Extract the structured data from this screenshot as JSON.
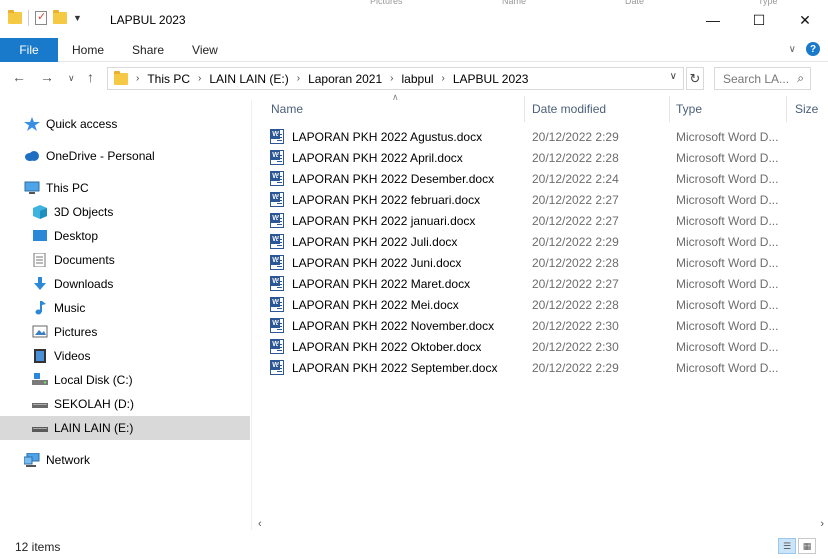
{
  "window": {
    "title": "LAPBUL 2023",
    "background_bleed": [
      "Pictures",
      "Name",
      "Date",
      "Type"
    ]
  },
  "ribbon": {
    "file_tab": "File",
    "tabs": [
      "Home",
      "Share",
      "View"
    ]
  },
  "address": {
    "breadcrumbs": [
      "This PC",
      "LAIN LAIN (E:)",
      "Laporan 2021",
      "labpul",
      "LAPBUL 2023"
    ],
    "search_placeholder": "Search LA..."
  },
  "nav_pane": {
    "items": [
      {
        "label": "Quick access",
        "icon": "star-icon"
      },
      {
        "label": "OneDrive - Personal",
        "icon": "cloud-icon"
      },
      {
        "label": "This PC",
        "icon": "computer-icon"
      },
      {
        "label": "3D Objects",
        "icon": "cube-icon"
      },
      {
        "label": "Desktop",
        "icon": "desktop-icon"
      },
      {
        "label": "Documents",
        "icon": "documents-icon"
      },
      {
        "label": "Downloads",
        "icon": "download-icon"
      },
      {
        "label": "Music",
        "icon": "music-icon"
      },
      {
        "label": "Pictures",
        "icon": "pictures-icon"
      },
      {
        "label": "Videos",
        "icon": "videos-icon"
      },
      {
        "label": "Local Disk (C:)",
        "icon": "drive-icon"
      },
      {
        "label": "SEKOLAH (D:)",
        "icon": "drive-icon"
      },
      {
        "label": "LAIN LAIN (E:)",
        "icon": "drive-icon",
        "selected": true
      },
      {
        "label": "Network",
        "icon": "network-icon"
      }
    ]
  },
  "file_list": {
    "columns": [
      "Name",
      "Date modified",
      "Type",
      "Size"
    ],
    "files": [
      {
        "name": "LAPORAN PKH 2022 Agustus.docx",
        "date": "20/12/2022 2:29",
        "type": "Microsoft Word D..."
      },
      {
        "name": "LAPORAN PKH 2022 April.docx",
        "date": "20/12/2022 2:28",
        "type": "Microsoft Word D..."
      },
      {
        "name": "LAPORAN PKH 2022 Desember.docx",
        "date": "20/12/2022 2:24",
        "type": "Microsoft Word D..."
      },
      {
        "name": "LAPORAN PKH 2022 februari.docx",
        "date": "20/12/2022 2:27",
        "type": "Microsoft Word D..."
      },
      {
        "name": "LAPORAN PKH 2022 januari.docx",
        "date": "20/12/2022 2:27",
        "type": "Microsoft Word D..."
      },
      {
        "name": "LAPORAN PKH 2022 Juli.docx",
        "date": "20/12/2022 2:29",
        "type": "Microsoft Word D..."
      },
      {
        "name": "LAPORAN PKH 2022 Juni.docx",
        "date": "20/12/2022 2:28",
        "type": "Microsoft Word D..."
      },
      {
        "name": "LAPORAN PKH 2022 Maret.docx",
        "date": "20/12/2022 2:27",
        "type": "Microsoft Word D..."
      },
      {
        "name": "LAPORAN PKH 2022 Mei.docx",
        "date": "20/12/2022 2:28",
        "type": "Microsoft Word D..."
      },
      {
        "name": "LAPORAN PKH 2022 November.docx",
        "date": "20/12/2022 2:30",
        "type": "Microsoft Word D..."
      },
      {
        "name": "LAPORAN PKH 2022 Oktober.docx",
        "date": "20/12/2022 2:30",
        "type": "Microsoft Word D..."
      },
      {
        "name": "LAPORAN PKH 2022 September.docx",
        "date": "20/12/2022 2:29",
        "type": "Microsoft Word D..."
      }
    ]
  },
  "status": {
    "item_count": "12 items"
  },
  "colors": {
    "accent": "#1979ca",
    "selection": "#d9d9d9",
    "header_text": "#4c607a",
    "muted_text": "#6d6d6d"
  }
}
